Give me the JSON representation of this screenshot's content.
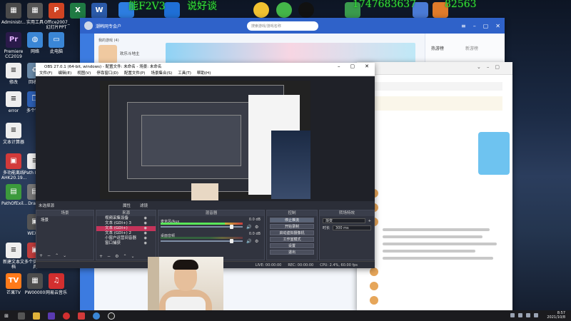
{
  "overlay": {
    "line1": "能F2V3",
    "line2": "说好谈",
    "line3": "1747683637",
    "line4": "82563"
  },
  "desktop_icons": [
    "Administr...",
    "实用工具",
    "Office2007_幻灯片PPT",
    "",
    "",
    "Premiere CC2019",
    "网络",
    "此电脑",
    "修改",
    "回收站",
    "error",
    "多个窗口",
    "文本计算器",
    "多功能离线AHK20.19...",
    "Path Bui...",
    "PathOfExil...",
    "Drav...",
    "新建文本文档",
    "多个实用工具",
    "WEXI...",
    "芒果TV",
    "PW00000",
    "网易云音乐"
  ],
  "game_window": {
    "title": "潮韩网专会户",
    "search_placeholder": "搜索游戏/游戏名称",
    "recent": "我的游戏 (4)",
    "tab_hot": "热游榜",
    "tab_new": "新游榜",
    "game_name": "欢乐斗地主"
  },
  "obs": {
    "title": "OBS 27.0.1 (64-bit, windows) - 配置文件: 未命名 - 场景: 未命名",
    "menu": [
      "文件(F)",
      "编辑(E)",
      "视图(V)",
      "停靠窗口(D)",
      "配置文件(P)",
      "场景集合(S)",
      "工具(T)",
      "帮助(H)"
    ],
    "no_source": "未选择源",
    "properties": "属性",
    "filters": "滤镜",
    "docks": {
      "scenes": "场景",
      "sources": "来源",
      "mixer": "混音器",
      "controls": "控制",
      "transitions": "转场特效"
    },
    "scenes": [
      "场景"
    ],
    "sources": [
      {
        "label": "视频采集设备",
        "active": false
      },
      {
        "label": "文本 (GDI+) 3",
        "active": false
      },
      {
        "label": "文本 (GDI+)",
        "active": true
      },
      {
        "label": "文本 (GDI+) 2",
        "active": false
      },
      {
        "label": "小窗户运营间音器",
        "active": false
      },
      {
        "label": "窗口捕获",
        "active": false
      }
    ],
    "mixer": [
      {
        "label": "麦克风/Aux",
        "db": "0.0 dB",
        "level": 0.78,
        "volume": 0.88
      },
      {
        "label": "桌面音频",
        "db": "0.0 dB",
        "level": 0.0,
        "volume": 0.88
      }
    ],
    "controls": [
      "停止推流",
      "开始录制",
      "启动虚拟摄像机",
      "工作室模式",
      "设置",
      "退出"
    ],
    "transition_name": "渐变",
    "duration_label": "时长",
    "duration_value": "300 ms",
    "status": {
      "live": "LIVE: 00:00:00",
      "rec": "REC: 00:00:00",
      "cpu": "CPU: 2.4%, 60.00 fps"
    }
  },
  "taskbar": {
    "time": "8:57",
    "date": "2021/10/8"
  }
}
